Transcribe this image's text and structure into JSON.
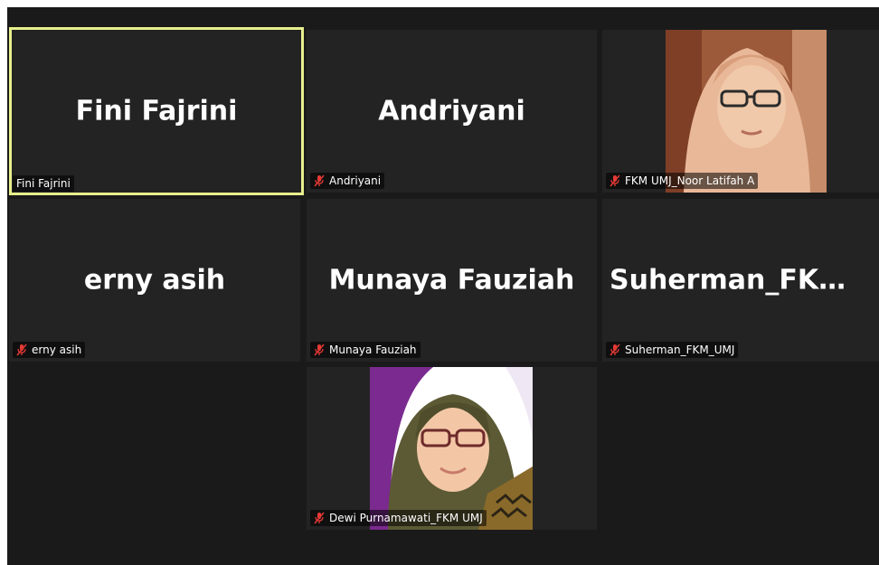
{
  "participants": [
    {
      "display": "Fini Fajrini",
      "label": "Fini Fajrini",
      "muted": false,
      "active": true
    },
    {
      "display": "Andriyani",
      "label": "Andriyani",
      "muted": true
    },
    {
      "display": "",
      "label": "FKM UMJ_Noor Latifah A",
      "muted": true,
      "video": true
    },
    {
      "display": "erny asih",
      "label": "erny asih",
      "muted": true
    },
    {
      "display": "Munaya Fauziah",
      "label": "Munaya Fauziah",
      "muted": true
    },
    {
      "display": "Suherman_FKM_...",
      "label": "Suherman_FKM_UMJ",
      "muted": true
    },
    {
      "display": "",
      "label": "Dewi Purnamawati_FKM UMJ",
      "muted": true,
      "video": true
    }
  ],
  "colors": {
    "active_border": "#e7ef8d",
    "mute_red": "#e53935",
    "tile_bg": "#232323"
  },
  "icons": {
    "mute": "microphone-muted-icon"
  }
}
